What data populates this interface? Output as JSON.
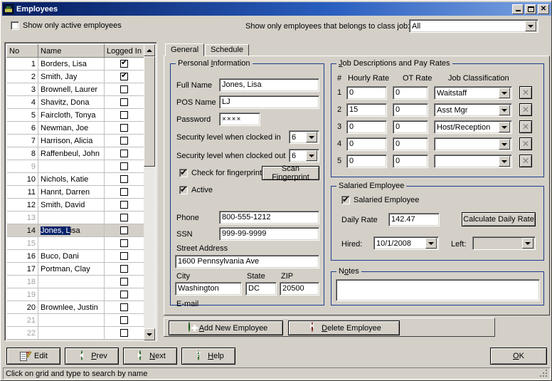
{
  "window": {
    "title": "Employees",
    "icon": "employees-icon",
    "buttons": {
      "minimize": "_",
      "maximize": "□",
      "close": "✕"
    }
  },
  "top": {
    "show_active_label": "Show only active employees",
    "show_active_checked": false,
    "class_job_label": "Show only employees that belongs to class job:",
    "class_job_value": "All"
  },
  "grid": {
    "headers": {
      "no": "No",
      "name": "Name",
      "logged_in": "Logged In"
    },
    "selected_row": 14,
    "selection_text": "Jones, L",
    "rows": [
      {
        "no": "1",
        "name": "Borders, Lisa",
        "logged_in": true
      },
      {
        "no": "2",
        "name": "Smith, Jay",
        "logged_in": true
      },
      {
        "no": "3",
        "name": "Brownell, Laurer",
        "logged_in": false
      },
      {
        "no": "4",
        "name": "Shavitz, Dona",
        "logged_in": false
      },
      {
        "no": "5",
        "name": "Faircloth, Tonya",
        "logged_in": false
      },
      {
        "no": "6",
        "name": "Newman, Joe",
        "logged_in": false
      },
      {
        "no": "7",
        "name": "Harrison, Alicia",
        "logged_in": false
      },
      {
        "no": "8",
        "name": "Raffenbeul, John",
        "logged_in": false
      },
      {
        "no": "9",
        "name": "",
        "logged_in": false
      },
      {
        "no": "10",
        "name": "Nichols, Katie",
        "logged_in": false
      },
      {
        "no": "11",
        "name": "Hannt, Darren",
        "logged_in": false
      },
      {
        "no": "12",
        "name": "Smith, David",
        "logged_in": false
      },
      {
        "no": "13",
        "name": "",
        "logged_in": false
      },
      {
        "no": "14",
        "name": "Jones, Lisa",
        "logged_in": false
      },
      {
        "no": "15",
        "name": "",
        "logged_in": false
      },
      {
        "no": "16",
        "name": "Buco, Dani",
        "logged_in": false
      },
      {
        "no": "17",
        "name": "Portman, Clay",
        "logged_in": false
      },
      {
        "no": "18",
        "name": "",
        "logged_in": false
      },
      {
        "no": "19",
        "name": "",
        "logged_in": false
      },
      {
        "no": "20",
        "name": "Brownlee, Justin",
        "logged_in": false
      },
      {
        "no": "21",
        "name": "",
        "logged_in": false
      },
      {
        "no": "22",
        "name": "",
        "logged_in": false
      }
    ]
  },
  "tabs": [
    {
      "label": "General",
      "active": true
    },
    {
      "label": "Schedule",
      "active": false
    }
  ],
  "personal": {
    "caption": "Personal Information",
    "full_name_label": "Full Name",
    "full_name_value": "Jones, Lisa",
    "pos_name_label": "POS Name",
    "pos_name_value": "LJ",
    "password_label": "Password",
    "password_value": "××××",
    "sec_in_label": "Security level when clocked in",
    "sec_in_value": "6",
    "sec_out_label": "Security level when clocked out",
    "sec_out_value": "6",
    "fingerprint_label": "Check for fingerprint",
    "fingerprint_checked": true,
    "scan_fingerprint_button": "Scan Fingerprint",
    "active_label": "Active",
    "active_checked": true,
    "phone_label": "Phone",
    "phone_value": "800-555-1212",
    "ssn_label": "SSN",
    "ssn_value": "999-99-9999",
    "street_label": "Street Address",
    "street_value": "1600 Pennsylvania Ave",
    "city_label": "City",
    "city_value": "Washington",
    "state_label": "State",
    "state_value": "DC",
    "zip_label": "ZIP",
    "zip_value": "20500",
    "email_label": "E-mail"
  },
  "jobs": {
    "caption": "Job Descriptions and Pay Rates",
    "headers": {
      "num": "#",
      "hourly": "Hourly Rate",
      "ot": "OT Rate",
      "classification": "Job Classification"
    },
    "rows": [
      {
        "num": "1",
        "hourly": "0",
        "ot": "0",
        "classification": "Waitstaff"
      },
      {
        "num": "2",
        "hourly": "15",
        "ot": "0",
        "classification": "Asst Mgr"
      },
      {
        "num": "3",
        "hourly": "0",
        "ot": "0",
        "classification": "Host/Reception"
      },
      {
        "num": "4",
        "hourly": "0",
        "ot": "0",
        "classification": ""
      },
      {
        "num": "5",
        "hourly": "0",
        "ot": "0",
        "classification": ""
      }
    ],
    "delete_glyph": "✕"
  },
  "salaried": {
    "caption": "Salaried Employee",
    "checkbox_label": "Salaried Employee",
    "checked": true,
    "daily_rate_label": "Daily Rate",
    "daily_rate_value": "142.47",
    "calculate_button": "Calculate Daily Rate",
    "hired_label": "Hired:",
    "hired_value": "10/1/2008",
    "left_label": "Left:",
    "left_value": ""
  },
  "notes": {
    "caption": "Notes",
    "value": ""
  },
  "actions": {
    "add_label": "Add New Employee",
    "add_icon": "green-plus-icon",
    "delete_label": "Delete Employee",
    "delete_icon": "red-x-icon"
  },
  "footer": {
    "edit_label": "Edit",
    "edit_icon": "notepad-pencil-icon",
    "prev_label": "Prev",
    "prev_icon": "green-left-arrow-icon",
    "next_label": "Next",
    "next_icon": "green-right-arrow-icon",
    "help_label": "Help",
    "help_icon": "green-question-icon",
    "ok_label": "OK",
    "status_text": "Click on grid and type to search by name"
  }
}
